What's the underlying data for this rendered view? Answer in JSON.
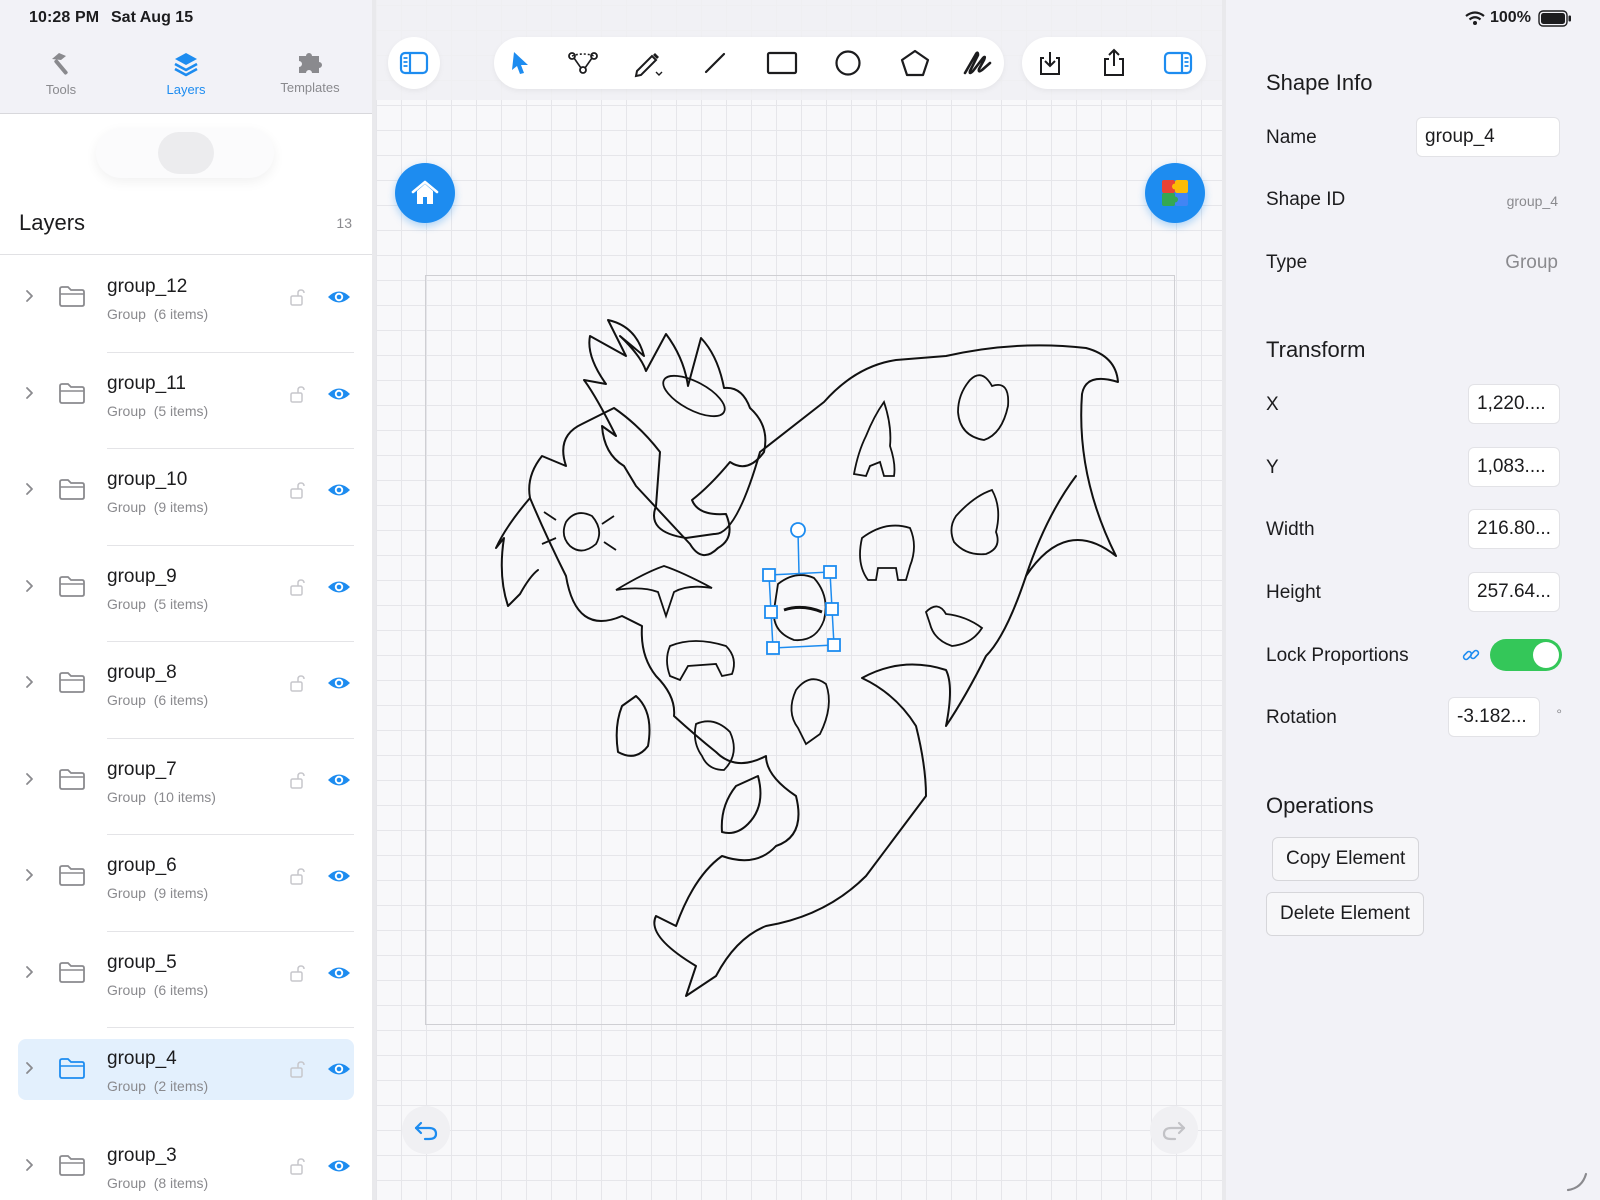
{
  "status_bar": {
    "time": "10:28 PM",
    "date": "Sat Aug 15",
    "battery": "100%"
  },
  "sidebar": {
    "tabs": [
      {
        "label": "Tools",
        "icon": "hammer-icon",
        "active": false
      },
      {
        "label": "Layers",
        "icon": "layers-icon",
        "active": true
      },
      {
        "label": "Templates",
        "icon": "puzzle-icon",
        "active": false
      }
    ],
    "layers_title": "Layers",
    "layers_count": "13",
    "layers": [
      {
        "name": "group_12",
        "meta": "Group  (6 items)",
        "selected": false
      },
      {
        "name": "group_11",
        "meta": "Group  (5 items)",
        "selected": false
      },
      {
        "name": "group_10",
        "meta": "Group  (9 items)",
        "selected": false
      },
      {
        "name": "group_9",
        "meta": "Group  (5 items)",
        "selected": false
      },
      {
        "name": "group_8",
        "meta": "Group  (6 items)",
        "selected": false
      },
      {
        "name": "group_7",
        "meta": "Group  (10 items)",
        "selected": false
      },
      {
        "name": "group_6",
        "meta": "Group  (9 items)",
        "selected": false
      },
      {
        "name": "group_5",
        "meta": "Group  (6 items)",
        "selected": false
      },
      {
        "name": "group_4",
        "meta": "Group  (2 items)",
        "selected": true
      },
      {
        "name": "group_3",
        "meta": "Group  (8 items)",
        "selected": false
      }
    ]
  },
  "toolbar": {
    "left": [
      "sidebar-toggle-icon"
    ],
    "tools": [
      "select-arrow-icon",
      "node-edit-icon",
      "pen-icon",
      "line-icon",
      "rectangle-icon",
      "ellipse-icon",
      "polygon-icon",
      "freehand-icon"
    ],
    "right": [
      "import-icon",
      "share-icon",
      "inspector-toggle-icon"
    ]
  },
  "inspector": {
    "shape_info_title": "Shape Info",
    "name_label": "Name",
    "name_value": "group_4",
    "shape_id_label": "Shape ID",
    "shape_id_value": "group_4",
    "type_label": "Type",
    "type_value": "Group",
    "transform_title": "Transform",
    "x_label": "X",
    "x_value": "1,220....",
    "y_label": "Y",
    "y_value": "1,083....",
    "width_label": "Width",
    "width_value": "216.80...",
    "height_label": "Height",
    "height_value": "257.64...",
    "lock_label": "Lock Proportions",
    "lock_on": true,
    "rotation_label": "Rotation",
    "rotation_value": "-3.182...",
    "rotation_unit": "°",
    "operations_title": "Operations",
    "copy_label": "Copy Element",
    "delete_label": "Delete Element"
  },
  "colors": {
    "accent": "#1d8cf0",
    "toggle_on": "#34c759",
    "selection": "#e3f0fd"
  }
}
